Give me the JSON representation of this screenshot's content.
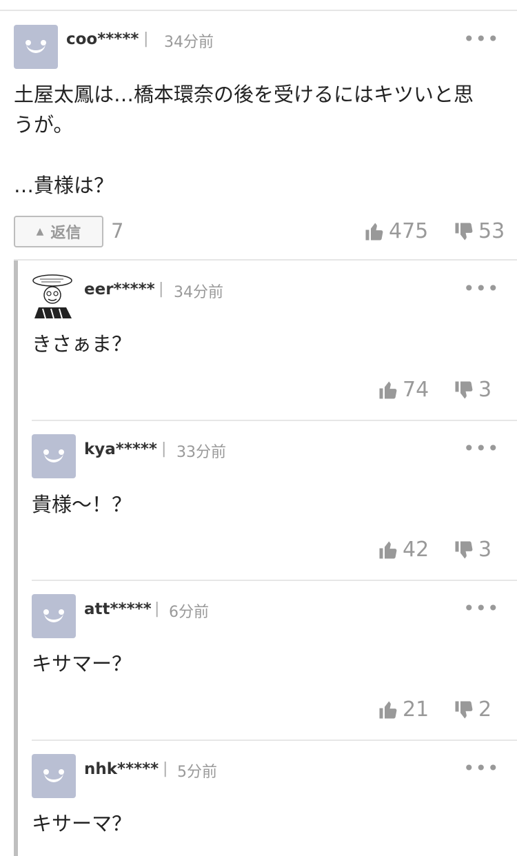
{
  "comments": [
    {
      "user": "coo*****",
      "time": "34分前",
      "text": "土屋太鳳は…橋本環奈の後を受けるにはキツいと思\nうが。\n\n…貴様は？",
      "reply_label": "返信",
      "reply_count": "7",
      "likes": "475",
      "dislikes": "53"
    }
  ],
  "replies": [
    {
      "user": "eer*****",
      "time": "34分前",
      "text": "きさぁま？",
      "likes": "74",
      "dislikes": "3"
    },
    {
      "user": "kya*****",
      "time": "33分前",
      "text": "貴様〜！？",
      "likes": "42",
      "dislikes": "3"
    },
    {
      "user": "att*****",
      "time": "6分前",
      "text": "キサマー？",
      "likes": "21",
      "dislikes": "2"
    },
    {
      "user": "nhk*****",
      "time": "5分前",
      "text": "キサーマ？"
    }
  ],
  "separator": "|",
  "menu_glyph": "•••",
  "icons": {
    "like": "thumbs-up-icon",
    "dislike": "thumbs-down-icon",
    "reply": "triangle-up-icon"
  },
  "colors": {
    "avatar": "#b9bfd3",
    "muted": "#999999",
    "thread_bar": "#bfbfbf"
  }
}
